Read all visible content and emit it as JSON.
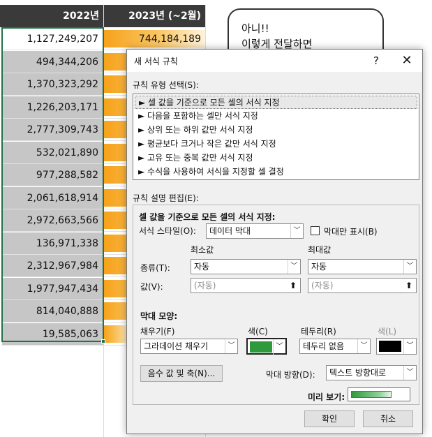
{
  "sheet": {
    "col_a_header": "2022년",
    "col_b_header": "2023년 (~2월)",
    "rows": [
      {
        "a": "1,127,249,207",
        "b": "744,184,189",
        "bar_fraction": 1.0
      },
      {
        "a": "494,344,206",
        "b": "",
        "bar_fraction": 1.0
      },
      {
        "a": "1,370,323,292",
        "b": "",
        "bar_fraction": 1.0
      },
      {
        "a": "1,226,203,171",
        "b": "",
        "bar_fraction": 1.0
      },
      {
        "a": "2,777,309,743",
        "b": "",
        "bar_fraction": 1.0
      },
      {
        "a": "532,021,890",
        "b": "",
        "bar_fraction": 1.0
      },
      {
        "a": "977,288,582",
        "b": "",
        "bar_fraction": 1.0
      },
      {
        "a": "2,061,618,914",
        "b": "",
        "bar_fraction": 1.0
      },
      {
        "a": "2,972,663,566",
        "b": "",
        "bar_fraction": 1.0
      },
      {
        "a": "136,971,338",
        "b": "",
        "bar_fraction": 1.0
      },
      {
        "a": "2,312,967,984",
        "b": "",
        "bar_fraction": 1.0
      },
      {
        "a": "1,977,947,434",
        "b": "",
        "bar_fraction": 0.7
      },
      {
        "a": "814,040,888",
        "b": "",
        "bar_fraction": 0.55
      },
      {
        "a": "19,585,063",
        "b": "",
        "bar_fraction": 0.25
      }
    ],
    "callout_line1": "아니!!",
    "callout_line2": "이렇게 전달하면"
  },
  "dialog": {
    "title": "새 서식 규칙",
    "help": "?",
    "close": "✕",
    "rule_type_label": "규칙 유형 선택(S):",
    "rule_types": [
      "► 셀 값을 기준으로 모든 셀의 서식 지정",
      "► 다음을 포함하는 셀만 서식 지정",
      "► 상위 또는 하위 값만 서식 지정",
      "► 평균보다 크거나 작은 값만 서식 지정",
      "► 고유 또는 중복 값만 서식 지정",
      "► 수식을 사용하여 서식을 지정할 셀 결정"
    ],
    "rule_desc_label": "규칙 설명 편집(E):",
    "section_title": "셀 값을 기준으로 모든 셀의 서식 지정:",
    "format_style_label": "서식 스타일(O):",
    "format_style_value": "데이터 막대",
    "bar_only_label": "막대만 표시(B)",
    "min_header": "최소값",
    "max_header": "최대값",
    "type_label": "종류(T):",
    "min_type": "자동",
    "max_type": "자동",
    "value_label": "값(V):",
    "min_value": "(자동)",
    "max_value": "(자동)",
    "bar_appearance_label": "막대 모양:",
    "fill_label": "채우기(F)",
    "fill_value": "그라데이션 채우기",
    "color_label": "색(C)",
    "fill_color": "#2e9a3b",
    "border_label": "테두리(R)",
    "border_value": "테두리 없음",
    "border_color_label": "색(L)",
    "border_color": "#000000",
    "neg_axis_button": "음수 값 및 축(N)...",
    "bar_direction_label": "막대 방향(D):",
    "bar_direction_value": "텍스트 방향대로",
    "preview_label": "미리 보기:",
    "ok": "확인",
    "cancel": "취소"
  }
}
